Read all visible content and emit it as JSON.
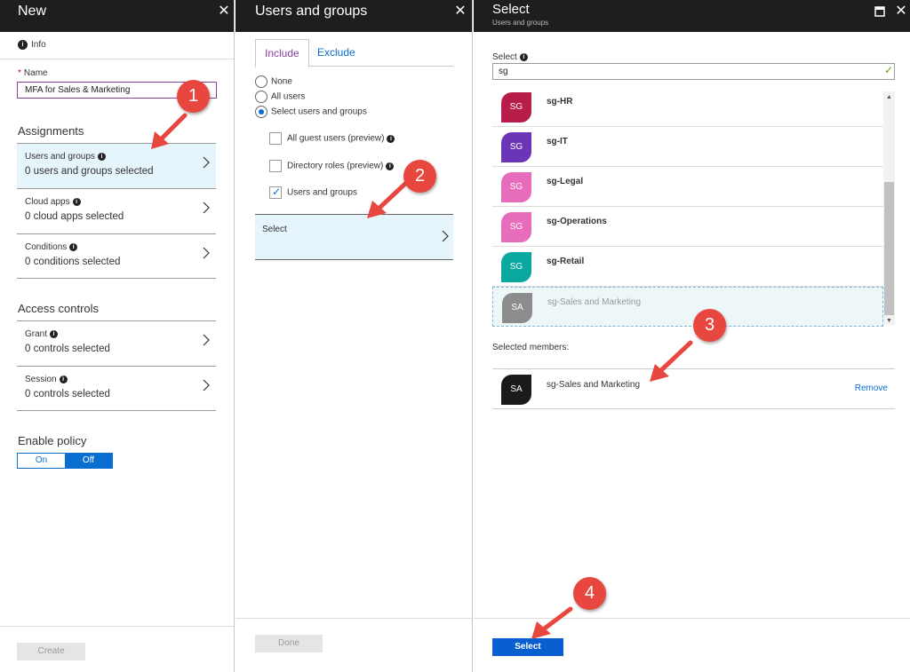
{
  "colors": {
    "header": "#1e1e1e",
    "accent": "#0a6ed1",
    "selected_bg": "#e6f4fb",
    "badge": "#e8473f"
  },
  "blade1": {
    "title": "New",
    "close_icon": "close-icon",
    "info_label": "Info",
    "name_label": "Name",
    "name_value": "MFA for Sales & Marketing",
    "assignments_title": "Assignments",
    "assignments": [
      {
        "label": "Users and groups",
        "value": "0 users and groups selected"
      },
      {
        "label": "Cloud apps",
        "value": "0 cloud apps selected"
      },
      {
        "label": "Conditions",
        "value": "0 conditions selected"
      }
    ],
    "access_title": "Access controls",
    "access": [
      {
        "label": "Grant",
        "value": "0 controls selected"
      },
      {
        "label": "Session",
        "value": "0 controls selected"
      }
    ],
    "enable_title": "Enable policy",
    "toggle_on": "On",
    "toggle_off": "Off",
    "create_label": "Create"
  },
  "blade2": {
    "title": "Users and groups",
    "tabs": [
      "Include",
      "Exclude"
    ],
    "radios": [
      {
        "label": "None",
        "checked": false
      },
      {
        "label": "All users",
        "checked": false
      },
      {
        "label": "Select users and groups",
        "checked": true
      }
    ],
    "checks": [
      {
        "label": "All guest users (preview)",
        "checked": false
      },
      {
        "label": "Directory roles (preview)",
        "checked": false
      },
      {
        "label": "Users and groups",
        "checked": true
      }
    ],
    "select_label": "Select",
    "done_label": "Done"
  },
  "blade3": {
    "title": "Select",
    "subtitle": "Users and groups",
    "search_label": "Select",
    "search_value": "sg",
    "results": [
      {
        "initials": "SG",
        "name": "sg-HR",
        "color": "#b81c48"
      },
      {
        "initials": "SG",
        "name": "sg-IT",
        "color": "#6b35b8"
      },
      {
        "initials": "SG",
        "name": "sg-Legal",
        "color": "#e86cbc"
      },
      {
        "initials": "SG",
        "name": "sg-Operations",
        "color": "#e86cbc"
      },
      {
        "initials": "SG",
        "name": "sg-Retail",
        "color": "#0aa89e"
      },
      {
        "initials": "SA",
        "name": "sg-Sales and Marketing",
        "color": "#8c8c8c"
      }
    ],
    "selected_label": "Selected members:",
    "selected_member": {
      "initials": "SA",
      "name": "sg-Sales and Marketing",
      "color": "#1a1a1a"
    },
    "remove_label": "Remove",
    "select_button": "Select"
  },
  "annotations": [
    "1",
    "2",
    "3",
    "4"
  ]
}
